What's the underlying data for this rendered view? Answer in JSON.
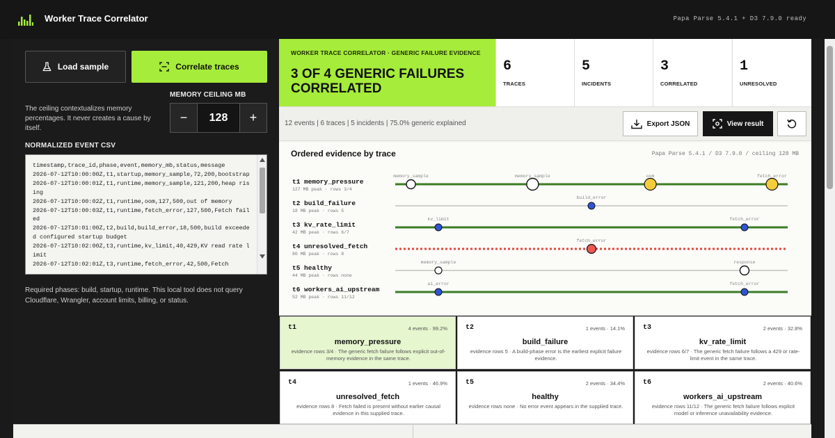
{
  "app": {
    "title": "Worker Trace Correlator",
    "lib_status": "Papa Parse 5.4.1 + D3 7.9.0 ready",
    "accent": "#a6ec3a"
  },
  "controls": {
    "load_label": "Load sample",
    "correlate_label": "Correlate traces",
    "memory_label": "MEMORY CEILING MB",
    "memory_value": "128",
    "minus": "−",
    "plus": "+",
    "ceiling_note": "The ceiling contextualizes memory percentages. It never creates a cause by itself.",
    "csv_label": "NORMALIZED EVENT CSV",
    "csv_text": "timestamp,trace_id,phase,event,memory_mb,status,message\n2026-07-12T10:00:00Z,t1,startup,memory_sample,72,200,bootstrap\n2026-07-12T10:00:01Z,t1,runtime,memory_sample,121,200,heap rising\n2026-07-12T10:00:02Z,t1,runtime,oom,127,500,out of memory\n2026-07-12T10:00:03Z,t1,runtime,fetch_error,127,500,Fetch failed\n2026-07-12T10:01:00Z,t2,build,build_error,18,500,build exceeded configured startup budget\n2026-07-12T10:02:00Z,t3,runtime,kv_limit,40,429,KV read rate limit\n2026-07-12T10:02:01Z,t3,runtime,fetch_error,42,500,Fetch",
    "phases_note": "Required phases: build, startup, runtime. This local tool does not query Cloudflare, Wrangler, account limits, billing, or status."
  },
  "hero": {
    "kicker": "WORKER TRACE CORRELATOR · GENERIC FAILURE EVIDENCE",
    "title": "3 OF 4 GENERIC FAILURES CORRELATED"
  },
  "stats": [
    {
      "value": "6",
      "label": "TRACES"
    },
    {
      "value": "5",
      "label": "INCIDENTS"
    },
    {
      "value": "3",
      "label": "CORRELATED"
    },
    {
      "value": "1",
      "label": "UNRESOLVED"
    }
  ],
  "toolbar": {
    "summary": "12 events | 6 traces | 5 incidents | 75.0% generic explained",
    "export_label": "Export JSON",
    "view_label": "View result"
  },
  "traces_panel": {
    "title": "Ordered evidence by trace",
    "meta": "Papa Parse 5.4.1 / D3 7.9.0 / ceiling 128 MB",
    "rows": [
      {
        "id": "t1",
        "name": "memory_pressure",
        "sub": "127 MB peak · rows 3/4",
        "line": "solid",
        "events": [
          {
            "t": 0.04,
            "label": "memory_sample",
            "kind": "open"
          },
          {
            "t": 0.35,
            "label": "memory_sample",
            "kind": "open-big"
          },
          {
            "t": 0.65,
            "label": "oom",
            "kind": "yellow"
          },
          {
            "t": 0.96,
            "label": "fetch_error",
            "kind": "yellow"
          }
        ]
      },
      {
        "id": "t2",
        "name": "build_failure",
        "sub": "18 MB peak · rows 5",
        "line": "none",
        "events": [
          {
            "t": 0.5,
            "label": "build_error",
            "kind": "blue"
          }
        ]
      },
      {
        "id": "t3",
        "name": "kv_rate_limit",
        "sub": "42 MB peak · rows 6/7",
        "line": "solid",
        "events": [
          {
            "t": 0.11,
            "label": "kv_limit",
            "kind": "blue"
          },
          {
            "t": 0.89,
            "label": "fetch_error",
            "kind": "blue"
          }
        ]
      },
      {
        "id": "t4",
        "name": "unresolved_fetch",
        "sub": "80 MB peak · rows 8",
        "line": "dashed",
        "events": [
          {
            "t": 0.5,
            "label": "fetch_error",
            "kind": "red"
          }
        ]
      },
      {
        "id": "t5",
        "name": "healthy",
        "sub": "44 MB peak · rows none",
        "line": "none",
        "events": [
          {
            "t": 0.11,
            "label": "memory_sample",
            "kind": "open-small"
          },
          {
            "t": 0.89,
            "label": "response",
            "kind": "open"
          }
        ]
      },
      {
        "id": "t6",
        "name": "workers_ai_upstream",
        "sub": "52 MB peak · rows 11/12",
        "line": "solid",
        "events": [
          {
            "t": 0.11,
            "label": "ai_error",
            "kind": "blue"
          },
          {
            "t": 0.89,
            "label": "fetch_error",
            "kind": "blue"
          }
        ]
      }
    ]
  },
  "cards": [
    {
      "id": "t1",
      "meta": "4 events · 99.2%",
      "title": "memory_pressure",
      "desc": "evidence rows 3/4 · The generic fetch failure follows explicit out-of-memory evidence in the same trace.",
      "highlight": true
    },
    {
      "id": "t2",
      "meta": "1 events · 14.1%",
      "title": "build_failure",
      "desc": "evidence rows 5 · A build-phase error is the earliest explicit failure evidence.",
      "highlight": false
    },
    {
      "id": "t3",
      "meta": "2 events · 32.8%",
      "title": "kv_rate_limit",
      "desc": "evidence rows 6/7 · The generic fetch failure follows a 429 or rate-limit event in the same trace.",
      "highlight": false
    },
    {
      "id": "t4",
      "meta": "1 events · 46.9%",
      "title": "unresolved_fetch",
      "desc": "evidence rows 8 · Fetch failed is present without earlier causal evidence in this supplied trace.",
      "highlight": false
    },
    {
      "id": "t5",
      "meta": "2 events · 34.4%",
      "title": "healthy",
      "desc": "evidence rows none · No error event appears in the supplied trace.",
      "highlight": false
    },
    {
      "id": "t6",
      "meta": "2 events · 40.6%",
      "title": "workers_ai_upstream",
      "desc": "evidence rows 11/12 · The generic fetch failure follows explicit model or inference unavailability evidence.",
      "highlight": false
    }
  ],
  "colors": {
    "line_green": "#3a7d22",
    "line_grey": "#d0d0cc",
    "line_red": "#e0493f",
    "dot_blue": "#2f55d4",
    "dot_yellow": "#f6cc3c",
    "dot_red": "#ec5a52"
  }
}
